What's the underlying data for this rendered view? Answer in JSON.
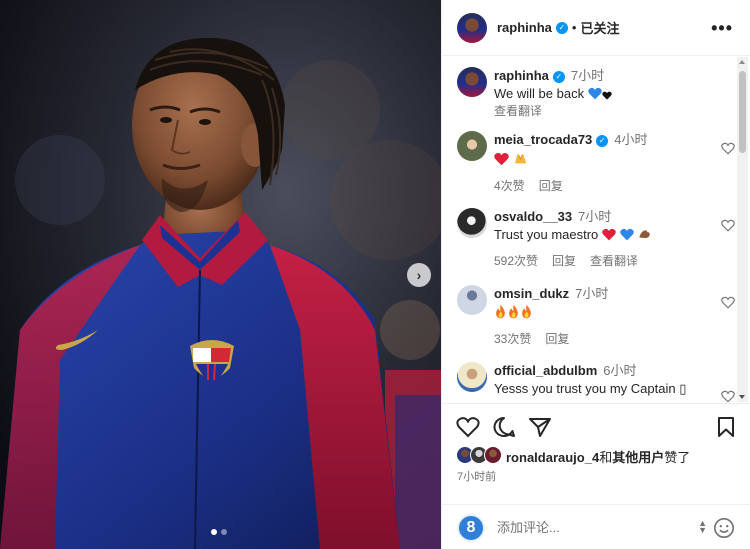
{
  "post": {
    "carousel_dots": 2,
    "active_dot": 0
  },
  "header": {
    "username": "raphinha",
    "separator": "•",
    "follow_status": "已关注",
    "more": "•••"
  },
  "caption": {
    "username": "raphinha",
    "time": "7小时",
    "text": "We will be back",
    "translate": "查看翻译"
  },
  "comments": [
    {
      "username": "meia_trocada73",
      "verified": true,
      "time": "4小时",
      "text": "",
      "likes": "4次赞",
      "reply": "回复",
      "translate": ""
    },
    {
      "username": "osvaldo__33",
      "verified": false,
      "time": "7小时",
      "text": "Trust you maestro",
      "likes": "592次赞",
      "reply": "回复",
      "translate": "查看翻译"
    },
    {
      "username": "omsin_dukz",
      "verified": false,
      "time": "7小时",
      "text": "",
      "likes": "33次赞",
      "reply": "回复",
      "translate": ""
    },
    {
      "username": "official_abdulbm",
      "verified": false,
      "time": "6小时",
      "text": "Yesss you trust you my Captain ▯",
      "likes": "",
      "reply": "",
      "translate": ""
    }
  ],
  "likes": {
    "user": "ronaldaraujo_4",
    "connector": "和",
    "others": "其他用户",
    "suffix": "赞了"
  },
  "post_time": "7小时前",
  "add_comment": {
    "placeholder": "添加评论..."
  },
  "me_avatar_letter": "8",
  "icons": [
    "heart-icon",
    "comment-icon",
    "share-icon",
    "bookmark-icon",
    "emoji-icon",
    "verified-icon",
    "next-icon"
  ],
  "colors": {
    "verified": "#0095f6",
    "muted": "#737373",
    "text": "#262626",
    "barca_blue": "#1e3a9c",
    "barca_red": "#a3153a"
  }
}
